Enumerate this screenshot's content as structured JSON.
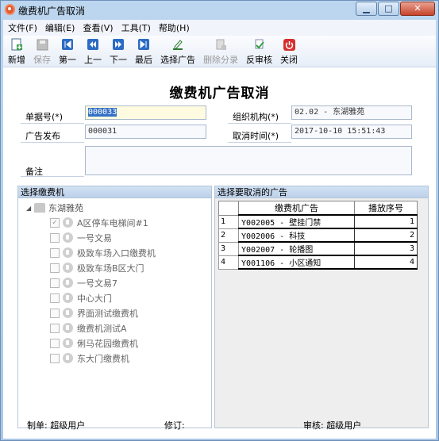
{
  "window": {
    "title": "缴费机广告取消",
    "minimize_glyph": "▁",
    "maximize_glyph": "□",
    "close_glyph": "✕"
  },
  "menu": [
    {
      "label": "文件(F)"
    },
    {
      "label": "编辑(E)"
    },
    {
      "label": "查看(V)"
    },
    {
      "label": "工具(T)"
    },
    {
      "label": "帮助(H)"
    }
  ],
  "toolbar": [
    {
      "label": "新增",
      "icon": "new-doc-icon",
      "enabled": true
    },
    {
      "label": "保存",
      "icon": "save-icon",
      "enabled": false
    },
    {
      "label": "第一",
      "icon": "first-record-icon",
      "enabled": true
    },
    {
      "label": "上一",
      "icon": "previous-record-icon",
      "enabled": true
    },
    {
      "label": "下一",
      "icon": "next-record-icon",
      "enabled": true
    },
    {
      "label": "最后",
      "icon": "last-record-icon",
      "enabled": true
    },
    {
      "label": "选择广告",
      "icon": "select-ad-icon",
      "enabled": true
    },
    {
      "label": "删除分录",
      "icon": "delete-entry-icon",
      "enabled": false
    },
    {
      "label": "反审核",
      "icon": "unaudit-icon",
      "enabled": true
    },
    {
      "label": "关闭",
      "icon": "power-close-icon",
      "enabled": true
    }
  ],
  "form": {
    "title": "缴费机广告取消",
    "bill_no_label": "单据号(*)",
    "bill_no_value": "000033",
    "org_label": "组织机构(*)",
    "org_value": "02.02 - 东湖雅苑",
    "ad_publish_label": "广告发布",
    "ad_publish_value": "000031",
    "cancel_time_label": "取消时间(*)",
    "cancel_time_value": "2017-10-10 15:51:43",
    "remark_label": "备注",
    "remark_value": ""
  },
  "machine_panel": {
    "header": "选择缴费机",
    "root": "东湖雅苑",
    "nodes": [
      {
        "label": "A区停车电梯间#1",
        "checked": true
      },
      {
        "label": "一号文易",
        "checked": false
      },
      {
        "label": "极致车场入口缴费机",
        "checked": false
      },
      {
        "label": "极致车场B区大门",
        "checked": false
      },
      {
        "label": "一号文易7",
        "checked": false
      },
      {
        "label": "中心大门",
        "checked": false
      },
      {
        "label": "界面测试缴费机",
        "checked": false
      },
      {
        "label": "缴费机测试A",
        "checked": false
      },
      {
        "label": "俐马花园缴费机",
        "checked": false
      },
      {
        "label": "东大门缴费机",
        "checked": false
      }
    ]
  },
  "ad_panel": {
    "header": "选择要取消的广告",
    "col_ad": "缴费机广告",
    "col_order": "播放序号",
    "rows": [
      {
        "n": "1",
        "ad": "Y002005 - 壁挂门禁",
        "order": "1"
      },
      {
        "n": "2",
        "ad": "Y002006 - 科技",
        "order": "2"
      },
      {
        "n": "3",
        "ad": "Y002007 - 轮播图",
        "order": "3"
      },
      {
        "n": "4",
        "ad": "Y001106 - 小区通知",
        "order": "4"
      }
    ]
  },
  "footer": {
    "maker": "制单: 超级用户",
    "editor": "修订:",
    "auditor": "审核: 超级用户"
  }
}
